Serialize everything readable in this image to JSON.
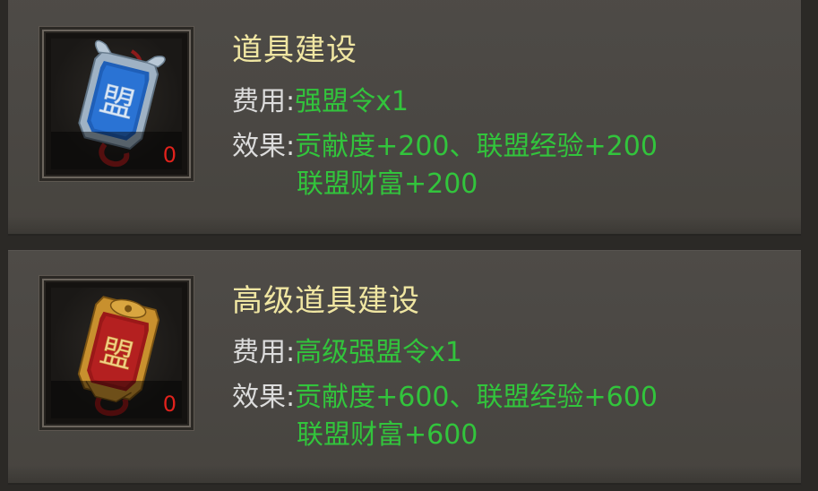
{
  "items": [
    {
      "title": "道具建设",
      "cost_label": "费用:",
      "cost_value": "强盟令x1",
      "effect_label": "效果:",
      "effect_line1": "贡献度+200、联盟经验+200",
      "effect_line2": "联盟财富+200",
      "count": "0",
      "icon_glyph": "盟",
      "icon": "blue-alliance-token-icon"
    },
    {
      "title": "高级道具建设",
      "cost_label": "费用:",
      "cost_value": "高级强盟令x1",
      "effect_label": "效果:",
      "effect_line1": "贡献度+600、联盟经验+600",
      "effect_line2": "联盟财富+600",
      "count": "0",
      "icon_glyph": "盟",
      "icon": "red-gold-alliance-token-icon"
    }
  ],
  "colors": {
    "title": "#f0e6a2",
    "label": "#dcdcdc",
    "value": "#32c43c",
    "count": "#e0221c"
  }
}
